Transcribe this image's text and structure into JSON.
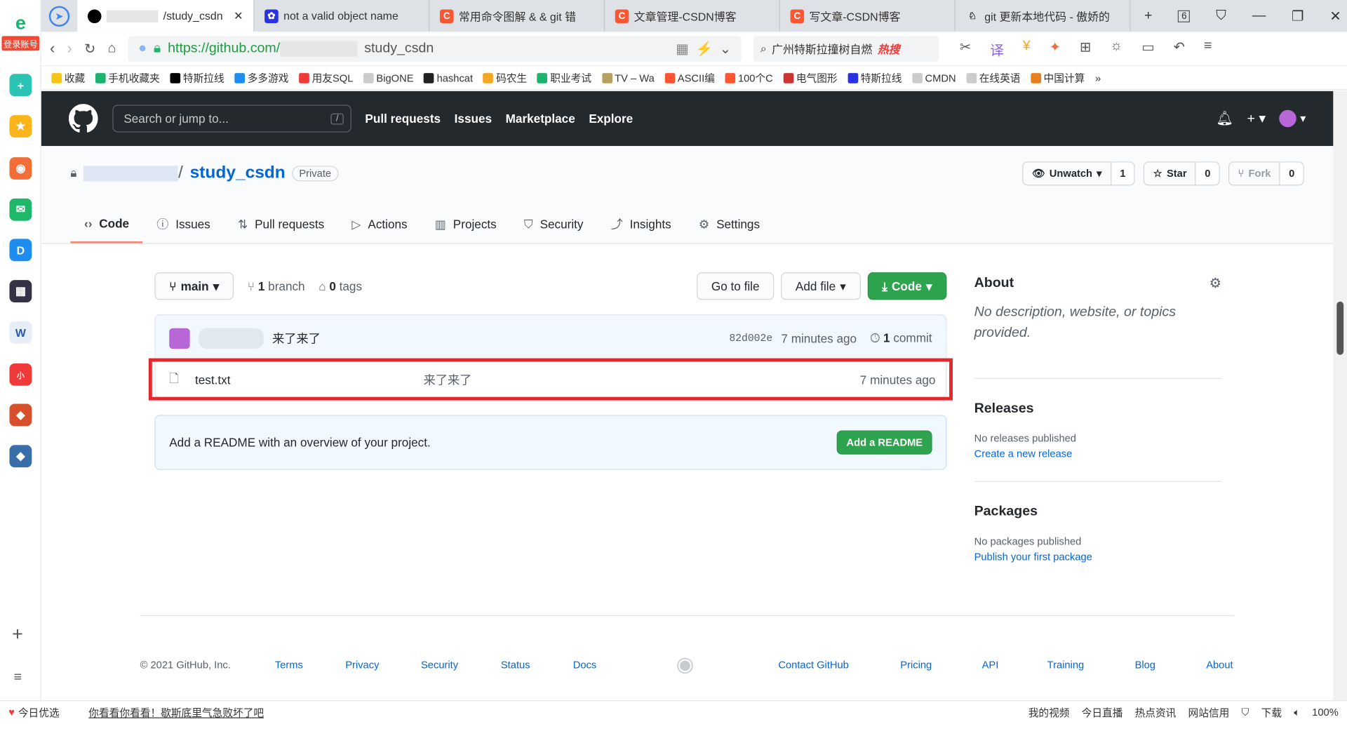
{
  "browser": {
    "tabs": [
      {
        "label": "/study_csdn",
        "active": true
      },
      {
        "label": "not a valid object name"
      },
      {
        "label": "常用命令图解 & & git 错"
      },
      {
        "label": "文章管理-CSDN博客"
      },
      {
        "label": "写文章-CSDN博客"
      },
      {
        "label": "git 更新本地代码 - 傲娇的"
      }
    ],
    "tab_count": "6",
    "url_prefix": "https://github.com/",
    "url_suffix": "study_csdn",
    "search_text": "广州特斯拉撞树自燃",
    "search_badge": "热搜",
    "login_badge": "登录账号",
    "bookmarks": [
      "收藏",
      "手机收藏夹",
      "特斯拉线",
      "多多游戏",
      "用友SQL",
      "BigONE",
      "hashcat",
      "码农生",
      "职业考试",
      "TV – Wa",
      "ASCII编",
      "100个C",
      "电气图形",
      "特斯拉线",
      "CMDN",
      "在线英语",
      "中国计算",
      "»"
    ],
    "status_bar": {
      "left": "今日优选",
      "news": "你看看你看看！歇斯底里气急败坏了吧",
      "items": [
        "我的视频",
        "今日直播",
        "热点资讯",
        "网站信用",
        "下载"
      ],
      "zoom": "100%"
    }
  },
  "header": {
    "search_placeholder": "Search or jump to...",
    "slash": "/",
    "nav": [
      "Pull requests",
      "Issues",
      "Marketplace",
      "Explore"
    ]
  },
  "repo": {
    "name": "study_csdn",
    "visibility": "Private",
    "sep": "/",
    "unwatch": "Unwatch",
    "watch_count": "1",
    "star": "Star",
    "star_count": "0",
    "fork": "Fork",
    "fork_count": "0",
    "tabs": [
      "Code",
      "Issues",
      "Pull requests",
      "Actions",
      "Projects",
      "Security",
      "Insights",
      "Settings"
    ]
  },
  "code": {
    "branch": "main",
    "branch_count": "1",
    "branch_label": "branch",
    "tag_count": "0",
    "tag_label": "tags",
    "go_to_file": "Go to file",
    "add_file": "Add file",
    "code_btn": "Code",
    "commit": {
      "message": "来了来了",
      "hash": "82d002e",
      "time": "7 minutes ago",
      "count": "1",
      "count_label": "commit"
    },
    "files": [
      {
        "name": "test.txt",
        "message": "来了来了",
        "time": "7 minutes ago"
      }
    ],
    "readme_prompt": "Add a README with an overview of your project.",
    "readme_btn": "Add a README"
  },
  "about": {
    "title": "About",
    "desc": "No description, website, or topics provided.",
    "releases_title": "Releases",
    "releases_none": "No releases published",
    "releases_link": "Create a new release",
    "packages_title": "Packages",
    "packages_none": "No packages published",
    "packages_link": "Publish your first package"
  },
  "footer": {
    "copyright": "© 2021 GitHub, Inc.",
    "links": [
      "Terms",
      "Privacy",
      "Security",
      "Status",
      "Docs",
      "Contact GitHub",
      "Pricing",
      "API",
      "Training",
      "Blog",
      "About"
    ]
  },
  "colors": {
    "header": "#24292e",
    "green": "#2ea44f",
    "link": "#0366d6",
    "highlight": "#e5262b"
  }
}
